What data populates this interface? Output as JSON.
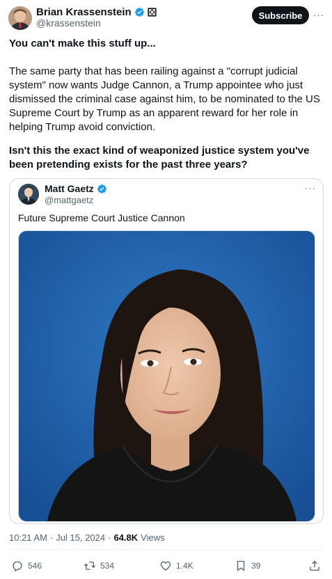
{
  "author": {
    "name": "Brian Krassenstein",
    "handle": "@krassenstein"
  },
  "header": {
    "subscribe_label": "Subscribe",
    "more_label": "···"
  },
  "tweet": {
    "line1": "You can't make this stuff up...",
    "line2": "The same party that has been railing against a \"corrupt judicial system\" now wants Judge Cannon, a Trump appointee who just dismissed the criminal case against him, to be nominated to the US Supreme Court by Trump as an apparent reward for her role in helping Trump avoid conviction.",
    "line3": "Isn't this the exact kind of weaponized justice system you've been pretending exists for the past three years?"
  },
  "quoted": {
    "name": "Matt Gaetz",
    "handle": "@mattgaetz",
    "text": "Future Supreme Court Justice Cannon",
    "more_label": "···"
  },
  "meta": {
    "time": "10:21 AM",
    "separator": "·",
    "date": "Jul 15, 2024",
    "separator2": "·",
    "views_count": "64.8K",
    "views_label": "Views"
  },
  "actions": {
    "replies": "546",
    "retweets": "534",
    "likes": "1.4K",
    "bookmarks": "39"
  },
  "colors": {
    "verified": "#1d9bf0",
    "text": "#0f1419",
    "secondary": "#536471",
    "border": "#cfd9de",
    "photo_background": "#1f5fae"
  }
}
